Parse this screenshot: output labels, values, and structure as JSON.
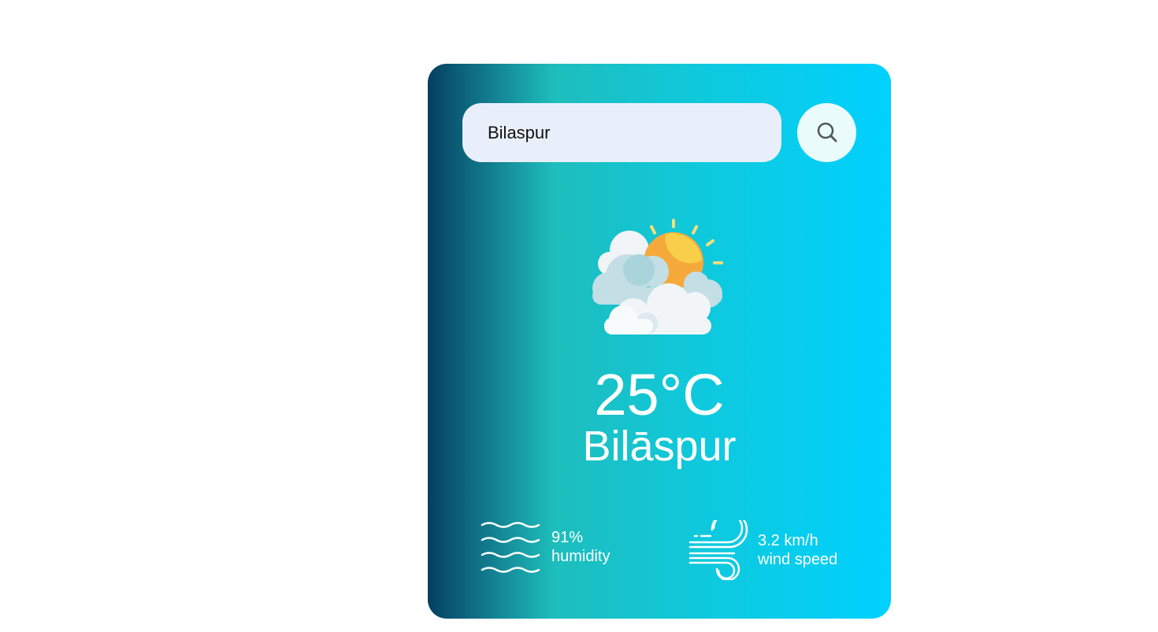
{
  "search": {
    "value": "Bilaspur",
    "placeholder": "",
    "icon": "search-icon"
  },
  "weather": {
    "icon": "partly-cloudy-icon",
    "temperature": "25°C",
    "city": "Bilāspur"
  },
  "details": {
    "humidity": {
      "icon": "humidity-icon",
      "value": "91%",
      "label": "humidity"
    },
    "wind": {
      "icon": "wind-icon",
      "value": "3.2 km/h",
      "label": "wind speed"
    }
  },
  "colors": {
    "gradient_start": "#053f62",
    "gradient_mid": "#1ebdbc",
    "gradient_end": "#00d1ff",
    "input_bg": "#e9effa",
    "button_bg": "#e9fbfb",
    "text": "#ffffff"
  }
}
